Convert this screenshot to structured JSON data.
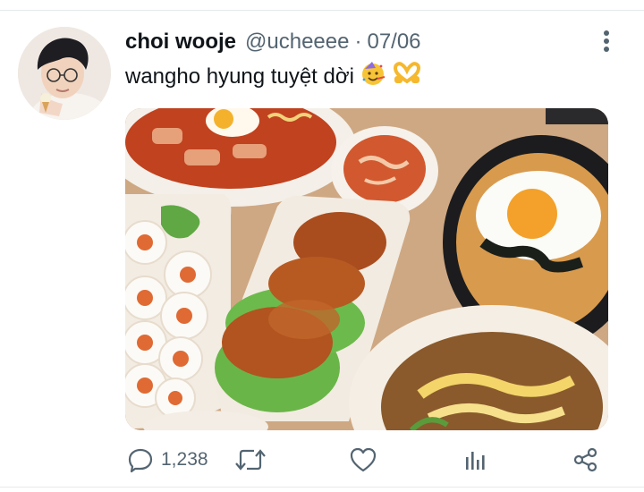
{
  "tweet": {
    "author_name": "choi wooje",
    "handle": "@ucheeee",
    "separator": "·",
    "date": "07/06",
    "text": "wangho hyung tuyệt dời",
    "emojis": [
      "party-face-emoji",
      "heart-hands-emoji"
    ]
  },
  "actions": {
    "reply_count": "1,238",
    "reply_icon": "reply-bubble-icon",
    "retweet_icon": "retweet-icon",
    "like_icon": "heart-icon",
    "analytics_icon": "analytics-icon",
    "share_icon": "share-icon"
  },
  "colors": {
    "text_primary": "#0f1419",
    "text_secondary": "#536471",
    "divider": "#e6e9eb"
  }
}
